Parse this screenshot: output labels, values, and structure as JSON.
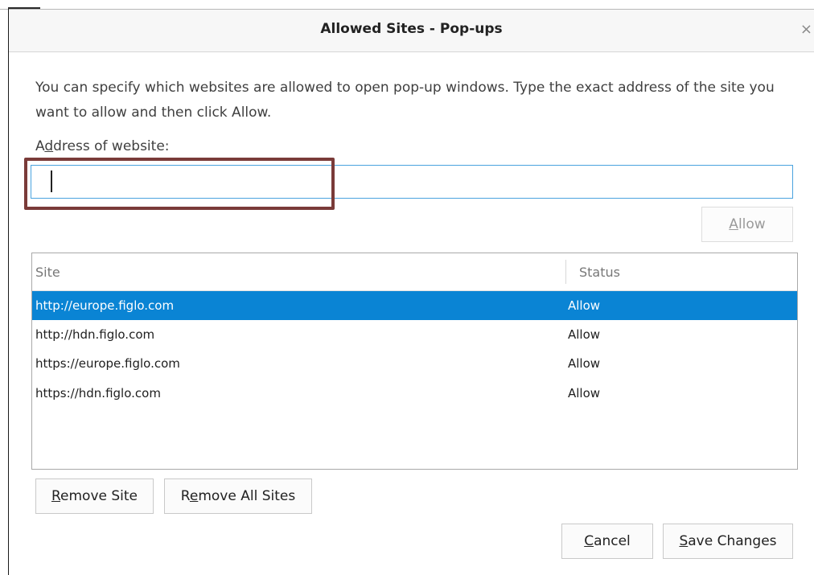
{
  "dialog": {
    "title": "Allowed Sites - Pop-ups",
    "close_glyph": "×",
    "description": "You can specify which websites are allowed to open pop-up windows. Type the exact address of the site you want to allow and then click Allow.",
    "address_label_accesskey": "d",
    "address_label_pre": "A",
    "address_label_post": "dress of website:",
    "address_value": "",
    "allow_button": {
      "accesskey": "A",
      "rest": "llow",
      "disabled": true
    }
  },
  "table": {
    "columns": [
      "Site",
      "Status"
    ],
    "rows": [
      {
        "site": "http://europe.figlo.com",
        "status": "Allow",
        "selected": true
      },
      {
        "site": "http://hdn.figlo.com",
        "status": "Allow",
        "selected": false
      },
      {
        "site": "https://europe.figlo.com",
        "status": "Allow",
        "selected": false
      },
      {
        "site": "https://hdn.figlo.com",
        "status": "Allow",
        "selected": false
      }
    ]
  },
  "buttons": {
    "remove_site": {
      "accesskey": "R",
      "rest": "emove Site"
    },
    "remove_all": {
      "pre": "R",
      "accesskey": "e",
      "rest": "move All Sites"
    },
    "cancel": {
      "accesskey": "C",
      "rest": "ancel"
    },
    "save": {
      "accesskey": "S",
      "rest": "ave Changes"
    }
  },
  "colors": {
    "selection": "#0a84d4",
    "input_focus_border": "#4aa3df",
    "annotation_box": "#7a3b39"
  }
}
